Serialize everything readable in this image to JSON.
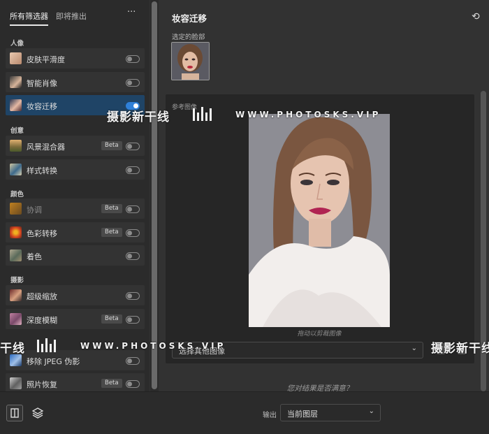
{
  "left_panel": {
    "tabs": [
      "所有筛选器",
      "即将推出"
    ],
    "more_menu": "···",
    "sections": {
      "portrait": "人像",
      "creative": "创意",
      "color": "颜色",
      "photography": "摄影"
    },
    "items": [
      {
        "label": "皮肤平滑度",
        "enabled": false,
        "beta": ""
      },
      {
        "label": "智能肖像",
        "enabled": false,
        "beta": ""
      },
      {
        "label": "妆容迁移",
        "enabled": true,
        "beta": ""
      },
      {
        "label": "风景混合器",
        "enabled": false,
        "beta": "Beta"
      },
      {
        "label": "样式转换",
        "enabled": false,
        "beta": ""
      },
      {
        "label": "协调",
        "enabled": false,
        "beta": "Beta"
      },
      {
        "label": "色彩转移",
        "enabled": false,
        "beta": "Beta"
      },
      {
        "label": "着色",
        "enabled": false,
        "beta": ""
      },
      {
        "label": "超级缩放",
        "enabled": false,
        "beta": ""
      },
      {
        "label": "深度模糊",
        "enabled": false,
        "beta": "Beta"
      },
      {
        "label": "移除 JPEG 伪影",
        "enabled": false,
        "beta": ""
      },
      {
        "label": "照片恢复",
        "enabled": false,
        "beta": "Beta"
      }
    ]
  },
  "main": {
    "title": "妆容迁移",
    "selected_face_label": "选定的脸部",
    "reference_label": "参考图像",
    "drag_hint": "拖动以剪裁图像",
    "select_image": "选择其他图像",
    "satisfied_prompt": "您对结果是否满意？"
  },
  "bottom_bar": {
    "output_label": "输出",
    "output_value": "当前图层"
  },
  "watermark": {
    "cn": "摄影新干线",
    "cn_partial_left": "干线",
    "en": "WWW.PHOTOSKS.VIP"
  },
  "colors": {
    "accent": "#2f80d8",
    "selected_row": "#1f4466",
    "panel": "#2b2b2b"
  },
  "icons": {
    "undo": "undo-icon",
    "compare": "compare-panel-icon",
    "layers": "layers-icon",
    "more": "more-icon"
  }
}
